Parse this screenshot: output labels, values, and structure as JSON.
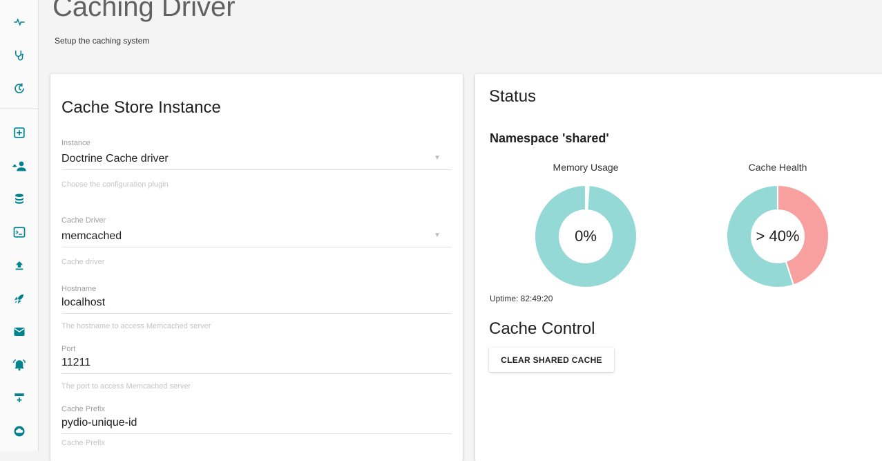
{
  "sidebar": {
    "items": [
      {
        "icon": "pulse-icon"
      },
      {
        "icon": "stethoscope-icon"
      },
      {
        "icon": "history-icon"
      },
      {
        "icon": "plugin-box-icon"
      },
      {
        "icon": "users-icon"
      },
      {
        "icon": "database-icon"
      },
      {
        "icon": "console-icon"
      },
      {
        "icon": "upload-icon"
      },
      {
        "icon": "rocket-icon"
      },
      {
        "icon": "mail-icon"
      },
      {
        "icon": "alarm-icon"
      },
      {
        "icon": "server-add-icon"
      },
      {
        "icon": "cloud-icon"
      }
    ]
  },
  "header": {
    "title": "Caching Driver",
    "subtitle": "Setup the caching system"
  },
  "store": {
    "title": "Cache Store Instance",
    "fields": [
      {
        "label": "Instance",
        "value": "Doctrine Cache driver",
        "help": "Choose the configuration plugin",
        "type": "select"
      },
      {
        "label": "Cache Driver",
        "value": "memcached",
        "help": "Cache driver",
        "type": "select"
      },
      {
        "label": "Hostname",
        "value": "localhost",
        "help": "The hostname to access Memcached server",
        "type": "text"
      },
      {
        "label": "Port",
        "value": "11211",
        "help": "The port to access Memcached server",
        "type": "text"
      },
      {
        "label": "Cache Prefix",
        "value": "pydio-unique-id",
        "help": "Cache Prefix",
        "type": "text"
      }
    ]
  },
  "status": {
    "title": "Status",
    "namespace_title": "Namespace 'shared'",
    "memory": {
      "label": "Memory Usage",
      "center": "0%",
      "used_fraction": 0.01
    },
    "health": {
      "label": "Cache Health",
      "center": "> 40%",
      "miss_fraction": 0.45
    },
    "uptime": "Uptime: 82:49:20",
    "control_title": "Cache Control",
    "clear_label": "CLEAR SHARED CACHE"
  },
  "colors": {
    "accent": "#4db6ac",
    "teal_chart": "#95d9d7",
    "pink_chart": "#f8a0a0",
    "sidebar_icon": "#00838f"
  }
}
